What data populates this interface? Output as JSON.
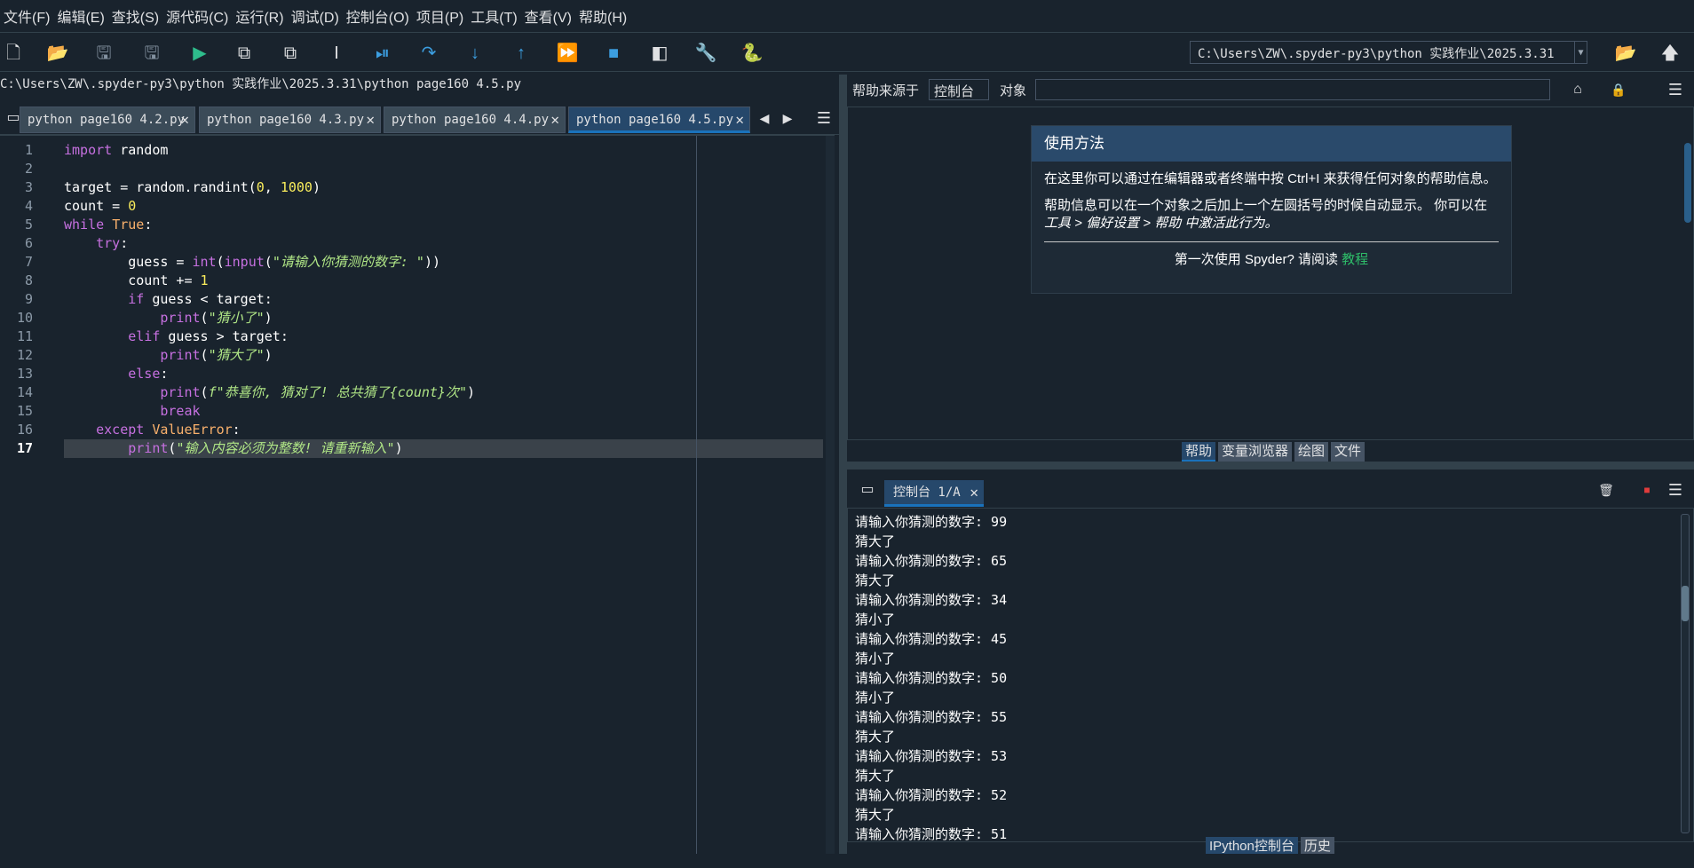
{
  "menu": [
    "文件(F)",
    "编辑(E)",
    "查找(S)",
    "源代码(C)",
    "运行(R)",
    "调试(D)",
    "控制台(O)",
    "项目(P)",
    "工具(T)",
    "查看(V)",
    "帮助(H)"
  ],
  "toolbar": {
    "icons": [
      "new-file-icon",
      "open-file-icon",
      "save-icon",
      "save-all-icon",
      "run-icon",
      "run-cell-icon",
      "run-cell-advance-icon",
      "run-selection-icon",
      "debug-icon",
      "step-over-icon",
      "step-into-icon",
      "step-return-icon",
      "continue-icon",
      "stop-icon",
      "maximize-pane-icon",
      "preferences-icon",
      "python-path-icon"
    ],
    "working_dir": "C:\\Users\\ZW\\.spyder-py3\\python 实践作业\\2025.3.31"
  },
  "editor": {
    "file_path": "C:\\Users\\ZW\\.spyder-py3\\python 实践作业\\2025.3.31\\python page160 4.5.py",
    "tabs": [
      {
        "label": "python page160 4.2.py",
        "active": false
      },
      {
        "label": "python page160 4.3.py",
        "active": false
      },
      {
        "label": "python page160 4.4.py",
        "active": false
      },
      {
        "label": "python page160 4.5.py",
        "active": true
      }
    ],
    "current_line": 17,
    "lines": [
      [
        {
          "t": "import",
          "c": "kw"
        },
        {
          "t": " random",
          "c": "plain"
        }
      ],
      [],
      [
        {
          "t": "target = random.randint(",
          "c": "plain"
        },
        {
          "t": "0",
          "c": "num"
        },
        {
          "t": ", ",
          "c": "plain"
        },
        {
          "t": "1000",
          "c": "num"
        },
        {
          "t": ")",
          "c": "plain"
        }
      ],
      [
        {
          "t": "count = ",
          "c": "plain"
        },
        {
          "t": "0",
          "c": "num"
        }
      ],
      [
        {
          "t": "while",
          "c": "kw"
        },
        {
          "t": " ",
          "c": "plain"
        },
        {
          "t": "True",
          "c": "cls"
        },
        {
          "t": ":",
          "c": "plain"
        }
      ],
      [
        {
          "t": "    ",
          "c": "plain"
        },
        {
          "t": "try",
          "c": "kw"
        },
        {
          "t": ":",
          "c": "plain"
        }
      ],
      [
        {
          "t": "        guess = ",
          "c": "plain"
        },
        {
          "t": "int",
          "c": "bi"
        },
        {
          "t": "(",
          "c": "plain"
        },
        {
          "t": "input",
          "c": "bi"
        },
        {
          "t": "(",
          "c": "plain"
        },
        {
          "t": "\"请输入你猜测的数字: \"",
          "c": "str"
        },
        {
          "t": "))",
          "c": "plain"
        }
      ],
      [
        {
          "t": "        count += ",
          "c": "plain"
        },
        {
          "t": "1",
          "c": "num"
        }
      ],
      [
        {
          "t": "        ",
          "c": "plain"
        },
        {
          "t": "if",
          "c": "kw"
        },
        {
          "t": " guess < target:",
          "c": "plain"
        }
      ],
      [
        {
          "t": "            ",
          "c": "plain"
        },
        {
          "t": "print",
          "c": "bi"
        },
        {
          "t": "(",
          "c": "plain"
        },
        {
          "t": "\"猜小了\"",
          "c": "str"
        },
        {
          "t": ")",
          "c": "plain"
        }
      ],
      [
        {
          "t": "        ",
          "c": "plain"
        },
        {
          "t": "elif",
          "c": "kw"
        },
        {
          "t": " guess > target:",
          "c": "plain"
        }
      ],
      [
        {
          "t": "            ",
          "c": "plain"
        },
        {
          "t": "print",
          "c": "bi"
        },
        {
          "t": "(",
          "c": "plain"
        },
        {
          "t": "\"猜大了\"",
          "c": "str"
        },
        {
          "t": ")",
          "c": "plain"
        }
      ],
      [
        {
          "t": "        ",
          "c": "plain"
        },
        {
          "t": "else",
          "c": "kw"
        },
        {
          "t": ":",
          "c": "plain"
        }
      ],
      [
        {
          "t": "            ",
          "c": "plain"
        },
        {
          "t": "print",
          "c": "bi"
        },
        {
          "t": "(",
          "c": "plain"
        },
        {
          "t": "f\"恭喜你, 猜对了! 总共猜了{count}次\"",
          "c": "str"
        },
        {
          "t": ")",
          "c": "plain"
        }
      ],
      [
        {
          "t": "            ",
          "c": "plain"
        },
        {
          "t": "break",
          "c": "kw"
        }
      ],
      [
        {
          "t": "    ",
          "c": "plain"
        },
        {
          "t": "except",
          "c": "kw"
        },
        {
          "t": " ",
          "c": "plain"
        },
        {
          "t": "ValueError",
          "c": "cls"
        },
        {
          "t": ":",
          "c": "plain"
        }
      ],
      [
        {
          "t": "        ",
          "c": "plain"
        },
        {
          "t": "print",
          "c": "bi"
        },
        {
          "t": "(",
          "c": "plain"
        },
        {
          "t": "\"输入内容必须为整数! 请重新输入\"",
          "c": "str"
        },
        {
          "t": ")",
          "c": "plain"
        }
      ]
    ]
  },
  "help": {
    "source_label": "帮助来源于",
    "source_value": "控制台",
    "object_label": "对象",
    "card_title": "使用方法",
    "p1": "在这里你可以通过在编辑器或者终端中按 Ctrl+I 来获得任何对象的帮助信息。",
    "p2a": "帮助信息可以在一个对象之后加上一个左圆括号的时候自动显示。 你可以在",
    "p2b": "工具 > 偏好设置 > 帮助 中激活此行为。",
    "footer_text": "第一次使用 Spyder? 请阅读 ",
    "footer_link": "教程",
    "pane_tabs": [
      "帮助",
      "变量浏览器",
      "绘图",
      "文件"
    ]
  },
  "console": {
    "tab_label": "控制台 1/A",
    "lines": [
      "请输入你猜测的数字: 99",
      "猜大了",
      "请输入你猜测的数字: 65",
      "猜大了",
      "请输入你猜测的数字: 34",
      "猜小了",
      "请输入你猜测的数字: 45",
      "猜小了",
      "请输入你猜测的数字: 50",
      "猜小了",
      "请输入你猜测的数字: 55",
      "猜大了",
      "请输入你猜测的数字: 53",
      "猜大了",
      "请输入你猜测的数字: 52",
      "猜大了",
      "请输入你猜测的数字: 51"
    ],
    "pane_tabs": [
      "IPython控制台",
      "历史"
    ]
  },
  "colors": {
    "accent": "#1a72bb",
    "background": "#19232d"
  }
}
